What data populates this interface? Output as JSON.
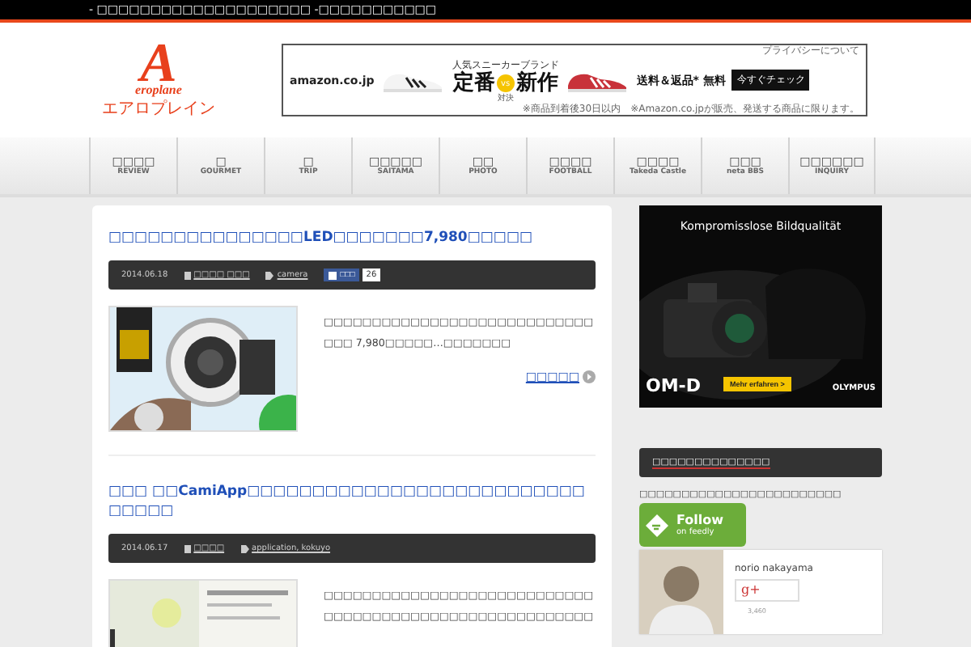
{
  "top_bar": {
    "text": "- □□□□□□□□□□□□□□□□□□□□ -□□□□□□□□□□□"
  },
  "logo": {
    "initial": "A",
    "word": "eroplane",
    "kana": "エアロプレイン"
  },
  "banner_ad": {
    "privacy": "プライバシーについて",
    "brand": "amazon.co.jp",
    "headline": "人気スニーカーブランド",
    "left": "定番",
    "vs": "vs",
    "right": "新作",
    "sub": "対決",
    "offer": "送料＆返品* 無料",
    "cta": "今すぐチェック",
    "note_1": "※商品到着後30日以内",
    "note_2": "※Amazon.co.jpが販売、発送する商品に限ります。"
  },
  "nav": [
    {
      "label": "□□□□",
      "sub": "REVIEW"
    },
    {
      "label": "□",
      "sub": "GOURMET"
    },
    {
      "label": "□",
      "sub": "TRIP"
    },
    {
      "label": "□□□□□",
      "sub": "SAITAMA"
    },
    {
      "label": "□□",
      "sub": "PHOTO"
    },
    {
      "label": "□□□□",
      "sub": "FOOTBALL"
    },
    {
      "label": "□□□□",
      "sub": "Takeda Castle"
    },
    {
      "label": "□□□",
      "sub": "neta BBS"
    },
    {
      "label": "□□□□□□",
      "sub": "INQUIRY"
    }
  ],
  "posts": [
    {
      "title": "□□□□□□□□□□□□□□□LED□□□□□□□7,980□□□□□",
      "date": "2014.06.18",
      "category": "□□□□ □□□",
      "tags": "camera",
      "like": "□□□",
      "like_count": "26",
      "excerpt": "□□□□□□□□□□□□□□□□□□□□□□□□□□□□□□□ 7,980□□□□□…□□□□□□□",
      "more": "□□□□□"
    },
    {
      "title": "□□□ □□CamiApp□□□□□□□□□□□□□□□□□□□□□□□□□□□□□□□",
      "date": "2014.06.17",
      "category": "□□□□",
      "tags": "application, kokuyo",
      "excerpt": "□□□□□□□□□□□□□□□□□□□□□□□□□□□□□□□□□□□□□□□□□□□□□□□□□□□□□□□□"
    }
  ],
  "side_ad": {
    "headline": "Kompromisslose Bildqualität",
    "cta": "Mehr erfahren >",
    "model": "OM-D",
    "brand": "OLYMPUS"
  },
  "widget": {
    "heading": "□□□□□□□□□□□□□□",
    "caption": "□□□□□□□□□□□□□□□□□□□□□□□□",
    "follow": "Follow",
    "follow_sub": "on feedly",
    "profile_name": "norio nakayama",
    "gplus": "g+",
    "followers": "3,460"
  }
}
